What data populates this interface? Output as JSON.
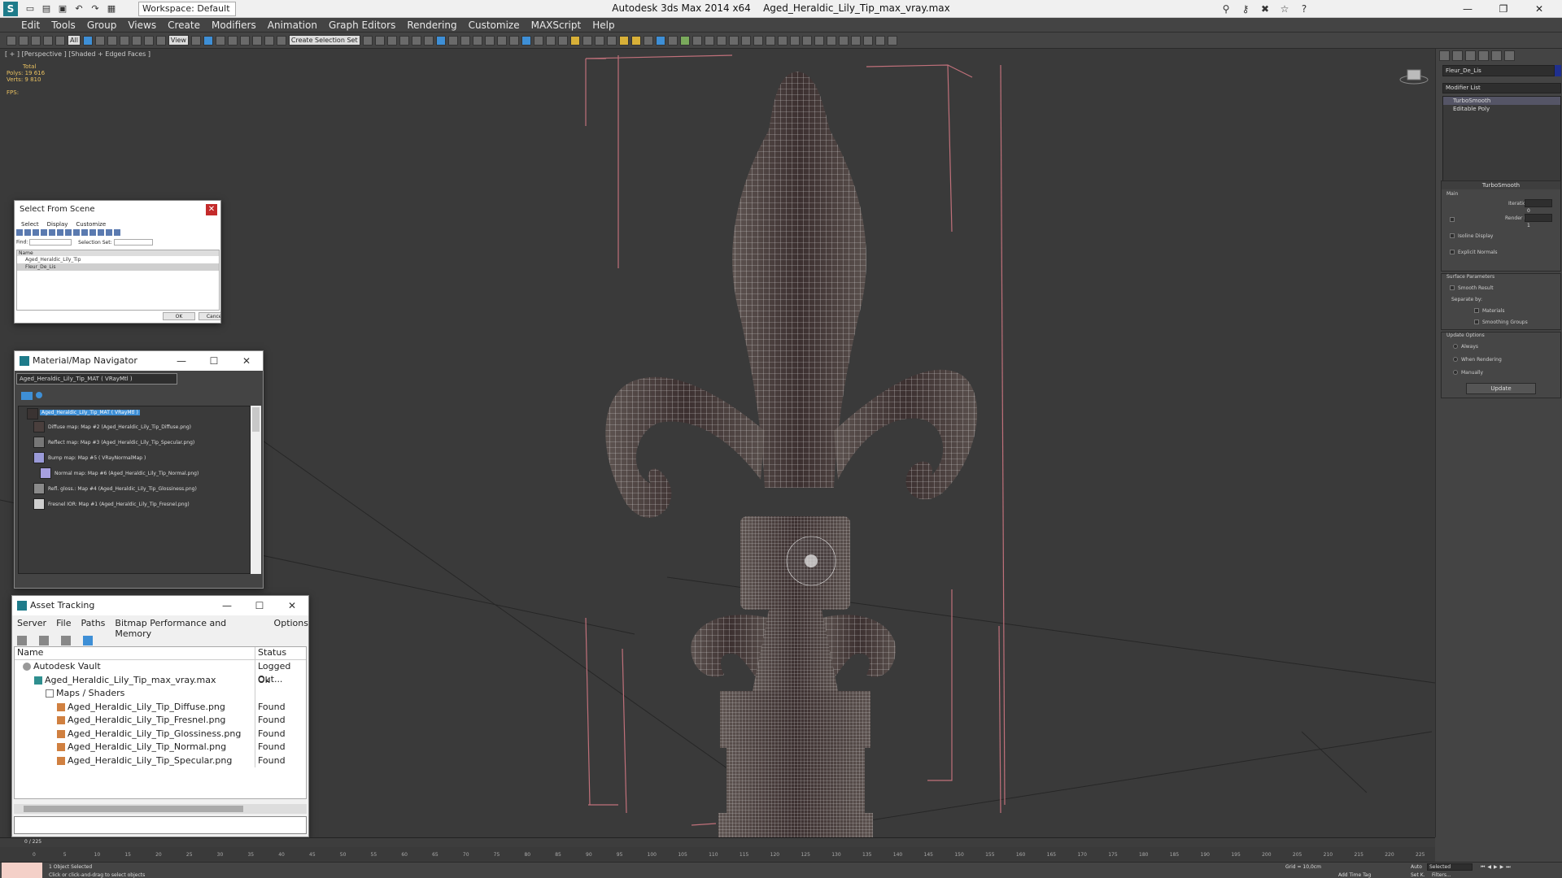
{
  "window": {
    "app_title": "Autodesk 3ds Max  2014 x64",
    "file_title": "Aged_Heraldic_Lily_Tip_max_vray.max",
    "workspace": "Workspace: Default",
    "controls": [
      "—",
      "❐",
      "✕"
    ]
  },
  "menu": [
    "Edit",
    "Tools",
    "Group",
    "Views",
    "Create",
    "Modifiers",
    "Animation",
    "Graph Editors",
    "Rendering",
    "Customize",
    "MAXScript",
    "Help"
  ],
  "toolbar": {
    "selection_filter": "All",
    "ref_coord": "View",
    "named_selection": "Create Selection Set"
  },
  "viewport": {
    "label": "[ + ] [Perspective ] [Shaded + Edged Faces ]",
    "stats": {
      "total_label": "Total",
      "polys_label": "Polys:",
      "polys": "19 616",
      "verts_label": "Verts:",
      "verts": "9 810",
      "fps_label": "FPS:"
    }
  },
  "command_panel": {
    "object_name": "Fleur_De_Lis",
    "modifier_list": "Modifier List",
    "object_color": "#1f2f8f",
    "stack": [
      "TurboSmooth",
      "Editable Poly"
    ],
    "turbosmooth": {
      "title": "TurboSmooth",
      "main": "Main",
      "iterations_label": "Iterations:",
      "iterations": "0",
      "render_iters_label": "Render Iters:",
      "render_iters": "1",
      "isoline": "Isoline Display",
      "explicit_normals": "Explicit Normals",
      "surface_params": "Surface Parameters",
      "smooth_result": "Smooth Result",
      "separate_by": "Separate by:",
      "materials": "Materials",
      "smoothing_groups": "Smoothing Groups",
      "update_options": "Update Options",
      "always": "Always",
      "when_rendering": "When Rendering",
      "manually": "Manually",
      "update_button": "Update"
    }
  },
  "select_from_scene": {
    "title": "Select From Scene",
    "menu": [
      "Select",
      "Display",
      "Customize"
    ],
    "find_label": "Find:",
    "selection_set_label": "Selection Set:",
    "column_name": "Name",
    "items": [
      "Aged_Heraldic_Lily_Tip",
      "Fleur_De_Lis"
    ],
    "ok": "OK",
    "cancel": "Cancel"
  },
  "material_navigator": {
    "title": "Material/Map Navigator",
    "path": "Aged_Heraldic_Lily_Tip_MAT  ( VRayMtl )",
    "root": "Aged_Heraldic_Lily_Tip_MAT  ( VRayMtl )",
    "maps": [
      "Diffuse map: Map #2 (Aged_Heraldic_Lily_Tip_Diffuse.png)",
      "Reflect map: Map #3 (Aged_Heraldic_Lily_Tip_Specular.png)",
      "Bump map: Map #5  ( VRayNormalMap )",
      "Normal map: Map #6 (Aged_Heraldic_Lily_Tip_Normal.png)",
      "Refl. gloss.: Map #4 (Aged_Heraldic_Lily_Tip_Glossiness.png)",
      "Fresnel IOR: Map #1 (Aged_Heraldic_Lily_Tip_Fresnel.png)"
    ]
  },
  "asset_tracking": {
    "title": "Asset Tracking",
    "menu": [
      "Server",
      "File",
      "Paths",
      "Bitmap Performance and Memory",
      "Options"
    ],
    "col_name": "Name",
    "col_status": "Status",
    "rows": [
      {
        "name": "Autodesk Vault",
        "status": "Logged Out..."
      },
      {
        "name": "Aged_Heraldic_Lily_Tip_max_vray.max",
        "status": "Ok"
      },
      {
        "name": "Maps / Shaders",
        "status": ""
      },
      {
        "name": "Aged_Heraldic_Lily_Tip_Diffuse.png",
        "status": "Found"
      },
      {
        "name": "Aged_Heraldic_Lily_Tip_Fresnel.png",
        "status": "Found"
      },
      {
        "name": "Aged_Heraldic_Lily_Tip_Glossiness.png",
        "status": "Found"
      },
      {
        "name": "Aged_Heraldic_Lily_Tip_Normal.png",
        "status": "Found"
      },
      {
        "name": "Aged_Heraldic_Lily_Tip_Specular.png",
        "status": "Found"
      }
    ]
  },
  "timeline": {
    "frame": "0 / 225",
    "ticks": [
      "0",
      "5",
      "10",
      "15",
      "20",
      "25",
      "30",
      "35",
      "40",
      "45",
      "50",
      "55",
      "60",
      "65",
      "70",
      "75",
      "80",
      "85",
      "90",
      "95",
      "100",
      "105",
      "110",
      "115",
      "120",
      "125",
      "130",
      "135",
      "140",
      "145",
      "150",
      "155",
      "160",
      "165",
      "170",
      "175",
      "180",
      "185",
      "190",
      "195",
      "200",
      "205",
      "210",
      "215",
      "220",
      "225"
    ]
  },
  "status": {
    "selected": "1 Object Selected",
    "prompt": "Click or click-and-drag to select objects",
    "grid": "Grid = 10,0cm",
    "auto": "Auto",
    "selected_dd": "Selected",
    "set_k": "Set K.",
    "filters": "Filters...",
    "add_time_tag": "Add Time Tag"
  }
}
